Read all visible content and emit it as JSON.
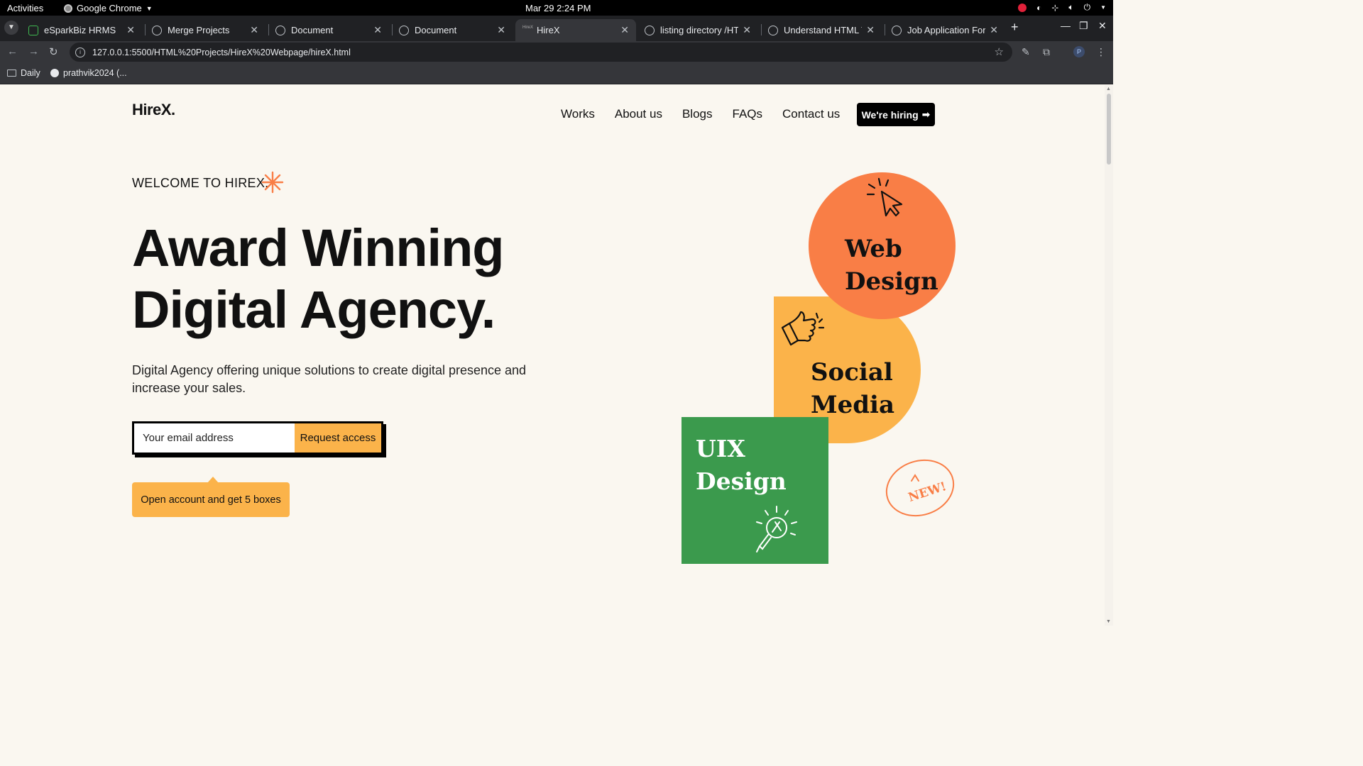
{
  "system": {
    "activities": "Activities",
    "app_name": "Google Chrome",
    "clock": "Mar 29  2:24 PM"
  },
  "browser": {
    "tabs": [
      {
        "label": "eSparkBiz HRMS"
      },
      {
        "label": "Merge Projects"
      },
      {
        "label": "Document"
      },
      {
        "label": "Document"
      },
      {
        "label": "HireX"
      },
      {
        "label": "listing directory /HTML"
      },
      {
        "label": "Understand HTML Ta"
      },
      {
        "label": "Job Application Form"
      }
    ],
    "url": "127.0.0.1:5500/HTML%20Projects/HireX%20Webpage/hireX.html",
    "profile_initial": "P",
    "bookmarks": [
      {
        "label": "Daily"
      },
      {
        "label": "prathvik2024 (..."
      }
    ]
  },
  "site": {
    "logo": "HireX.",
    "nav": [
      "Works",
      "About us",
      "Blogs",
      "FAQs",
      "Contact us"
    ],
    "hire_button": "We're hiring",
    "welcome": "WELCOME TO HIREX.",
    "headline_line1": "Award Winning",
    "headline_line2": "Digital Agency.",
    "subtitle": "Digital Agency offering unique solutions to create digital presence and increase your sales.",
    "email_placeholder": "Your email address",
    "request_button": "Request access",
    "tooltip": "Open account and get 5 boxes",
    "cards": {
      "web": {
        "line1": "Web",
        "line2": "Design",
        "color": "#f97e46"
      },
      "social": {
        "line1": "Social",
        "line2": "Media",
        "color": "#fbb34a"
      },
      "uix": {
        "line1": "UIX",
        "line2": "Design",
        "color": "#3b9a4d"
      }
    },
    "badge": "NEW!",
    "accent_color": "#fbb34a"
  }
}
